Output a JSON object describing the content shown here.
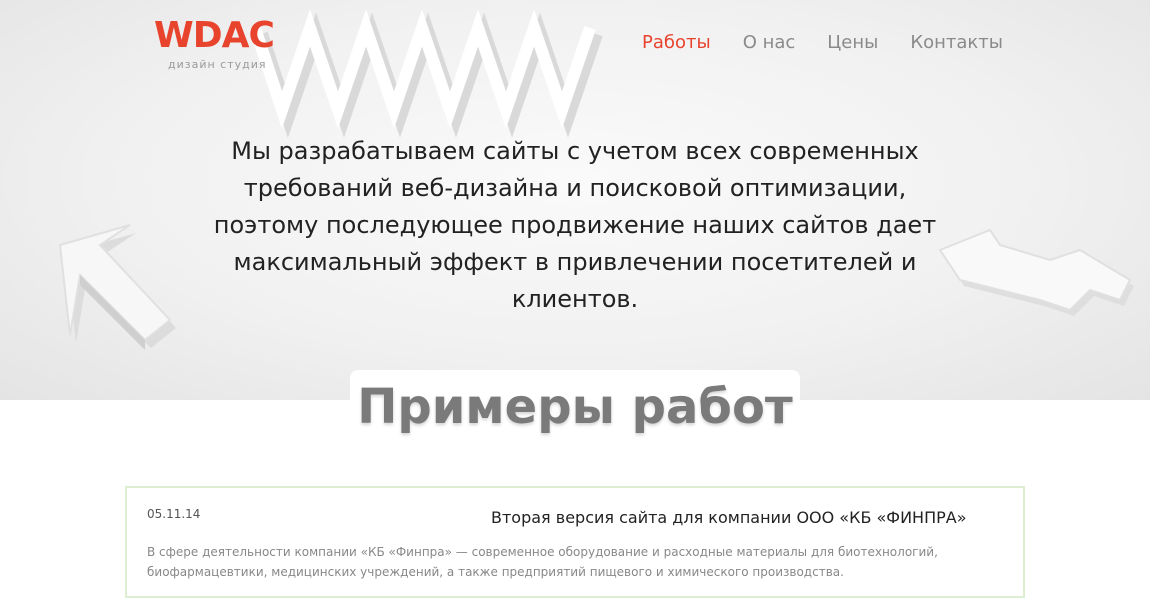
{
  "brand": {
    "logo_text": "WDAC",
    "tagline": "дизайн студия",
    "accent_color": "#e8432d"
  },
  "nav": {
    "items": [
      {
        "label": "Работы",
        "active": true
      },
      {
        "label": "О нас",
        "active": false
      },
      {
        "label": "Цены",
        "active": false
      },
      {
        "label": "Контакты",
        "active": false
      }
    ]
  },
  "hero": {
    "text": "Мы разрабатываем сайты с учетом всех современных требований веб-дизайна и поисковой оптимизации, поэтому последующее продвижение наших сайтов дает максимальный эффект в привлечении посетителей и клиентов."
  },
  "portfolio": {
    "title": "Примеры работ",
    "items": [
      {
        "date": "05.11.14",
        "title": "Вторая версия сайта для компании ООО «КБ «ФИНПРА»",
        "description": "В сфере деятельности компании «КБ «Финпра» — современное оборудование и расходные материалы для биотехнологий, биофармацевтики, медицинских учреждений, а также предприятий пищевого и химического производства."
      }
    ]
  }
}
